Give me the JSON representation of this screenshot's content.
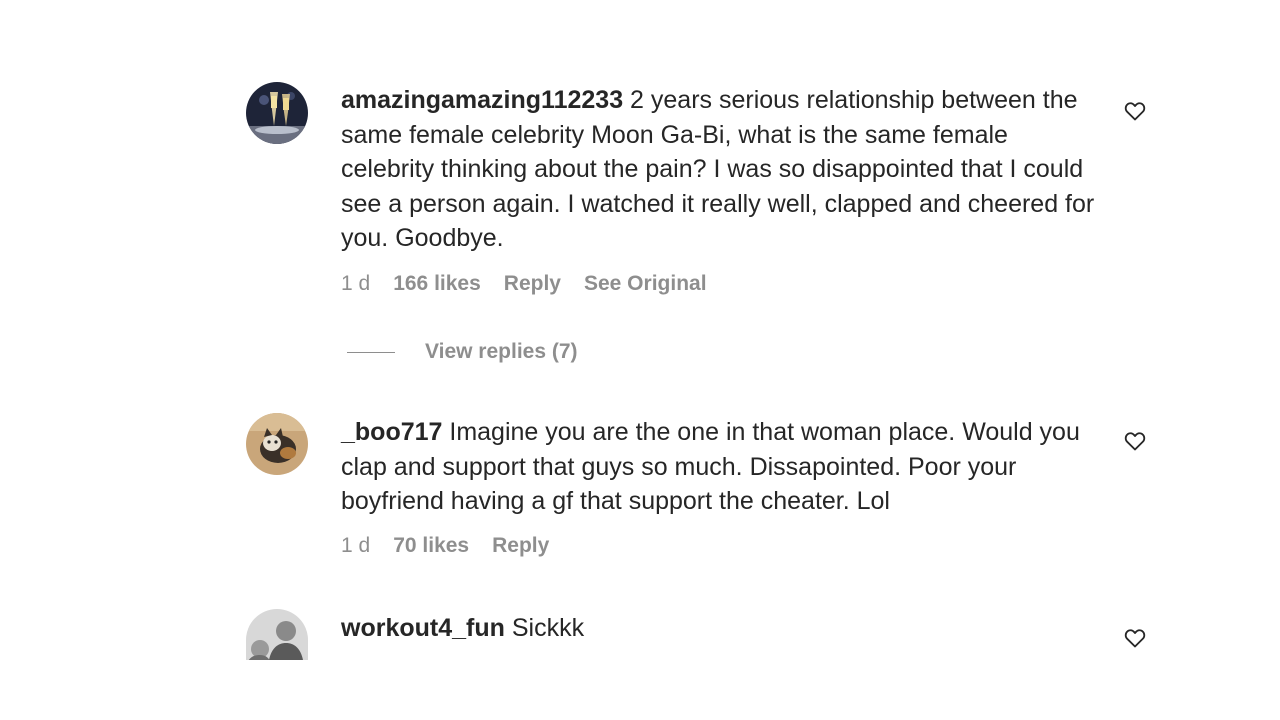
{
  "comments": [
    {
      "username": "amazingamazing112233",
      "text": " 2 years serious relationship between the same female celebrity Moon Ga-Bi, what is the same female celebrity thinking about the pain? I was so disappointed that I could see a person again. I watched it really well, clapped and cheered for you. Goodbye.",
      "time": "1 d",
      "likes": "166 likes",
      "reply_label": "Reply",
      "see_original_label": "See Original",
      "avatar_icon": "champagne-glasses-avatar"
    },
    {
      "username": "_boo717",
      "text": " Imagine you are the one in that woman place. Would you clap and support that guys so much. Dissapointed. Poor your boyfriend having a gf that support the cheater. Lol",
      "time": "1 d",
      "likes": "70 likes",
      "reply_label": "Reply",
      "avatar_icon": "cat-avatar"
    },
    {
      "username": "workout4_fun",
      "text": " Sickkk",
      "avatar_icon": "person-avatar"
    }
  ],
  "view_replies_label": "View replies (7)",
  "icons": {
    "like": "heart-outline-icon"
  },
  "colors": {
    "text": "#262626",
    "secondary": "#8e8e8e",
    "background": "#ffffff"
  }
}
